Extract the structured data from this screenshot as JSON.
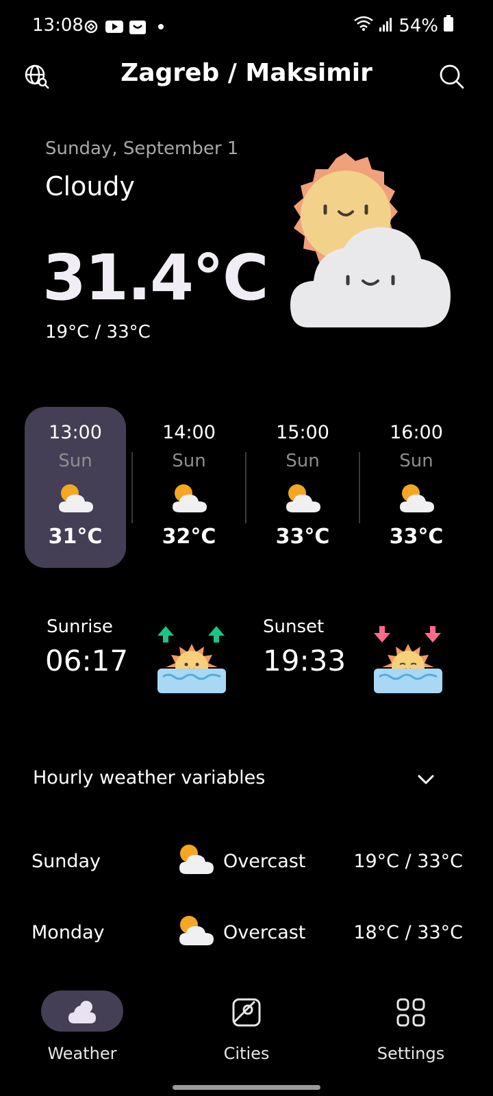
{
  "status_bar": {
    "time": "13:08",
    "battery": "54%",
    "icons_left": [
      "sync-icon",
      "youtube-icon",
      "shop-icon",
      "dot-icon"
    ],
    "icons_right": [
      "wifi-icon",
      "signal-icon",
      "battery-icon"
    ]
  },
  "header": {
    "title": "Zagreb / Maksimir",
    "left_icon": "globe-search-icon",
    "right_icon": "search-icon"
  },
  "current": {
    "date": "Sunday, September 1",
    "condition": "Cloudy",
    "temperature": "31.4°C",
    "min_max": "19°C / 33°C",
    "icon": "sun-behind-cloud-face-icon"
  },
  "hourly": [
    {
      "time": "13:00",
      "day": "Sun",
      "temp": "31°C",
      "icon": "partly-cloudy-icon",
      "selected": true
    },
    {
      "time": "14:00",
      "day": "Sun",
      "temp": "32°C",
      "icon": "partly-cloudy-icon",
      "selected": false
    },
    {
      "time": "15:00",
      "day": "Sun",
      "temp": "33°C",
      "icon": "partly-cloudy-icon",
      "selected": false
    },
    {
      "time": "16:00",
      "day": "Sun",
      "temp": "33°C",
      "icon": "partly-cloudy-icon",
      "selected": false
    }
  ],
  "sun": {
    "sunrise_label": "Sunrise",
    "sunrise_time": "06:17",
    "sunset_label": "Sunset",
    "sunset_time": "19:33"
  },
  "accordion": {
    "label": "Hourly weather variables"
  },
  "daily": [
    {
      "day": "Sunday",
      "condition": "Overcast",
      "range": "19°C / 33°C",
      "icon": "partly-cloudy-icon"
    },
    {
      "day": "Monday",
      "condition": "Overcast",
      "range": "18°C / 33°C",
      "icon": "partly-cloudy-icon"
    }
  ],
  "nav": {
    "items": [
      {
        "label": "Weather",
        "icon": "weather-cloud-icon",
        "active": true
      },
      {
        "label": "Cities",
        "icon": "map-pin-icon",
        "active": false
      },
      {
        "label": "Settings",
        "icon": "grid-icon",
        "active": false
      }
    ]
  },
  "colors": {
    "background": "#000000",
    "selected_card": "#453f55",
    "secondary_text": "#a8a8a8",
    "sunrise_arrow": "#2ecc71",
    "sunset_arrow": "#ff6b8a"
  }
}
